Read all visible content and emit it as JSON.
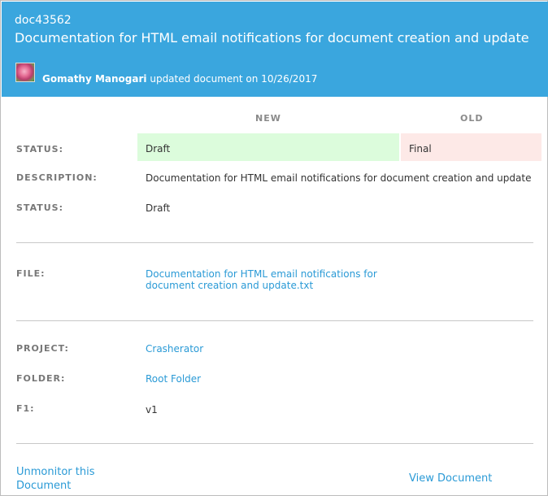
{
  "header": {
    "doc_id": "doc43562",
    "title": "Documentation for HTML email notifications for document creation and update",
    "avatar_icon": "profile-photo-flower",
    "user_name": "Gomathy Manogari",
    "action_text": " updated document on 10/26/2017"
  },
  "columns": {
    "new": "NEW",
    "old": "OLD"
  },
  "changes": {
    "status_label": "STATUS:",
    "status_new": "Draft",
    "status_old": "Final"
  },
  "details": {
    "description_label": "DESCRIPTION:",
    "description_value": "Documentation for HTML email notifications for document creation and update",
    "status_label": "STATUS:",
    "status_value": "Draft",
    "file_label": "FILE:",
    "file_value": "Documentation for HTML email notifications for document creation and update.txt",
    "project_label": "PROJECT:",
    "project_value": "Crasherator",
    "folder_label": "FOLDER:",
    "folder_value": "Root Folder",
    "f1_label": "F1:",
    "f1_value": "v1"
  },
  "footer": {
    "unmonitor_label": "Unmonitor this Document",
    "view_label": "View Document"
  },
  "colors": {
    "header_bg": "#3aa6de",
    "link": "#2a9ad6",
    "new_bg": "#dcfcdc",
    "old_bg": "#fde9e7"
  }
}
